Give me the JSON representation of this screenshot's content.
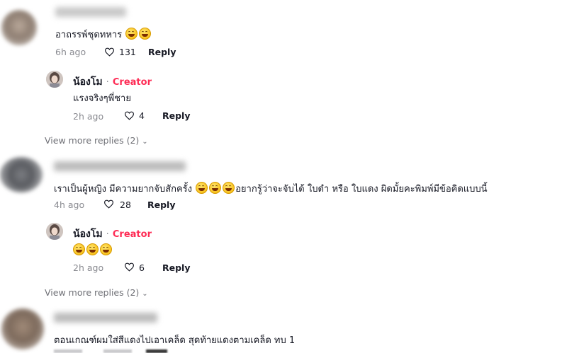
{
  "comments": [
    {
      "text": "อาถรรพ์ชุดทหาร",
      "emoji_count": 2,
      "time": "6h ago",
      "likes": "131",
      "reply_label": "Reply",
      "reply": {
        "name": "น้องโม",
        "separator": "·",
        "badge": "Creator",
        "text": "แรงจริงๆพี่ชาย",
        "time": "2h ago",
        "likes": "4",
        "reply_label": "Reply"
      },
      "view_more": "View more replies (2)"
    },
    {
      "text_part1": "เราเป็นผู้หญิง มีความยากจับสักครั้ง",
      "text_part2": "อยากรู้ว่าจะจับได้ ใบดำ หรือ ใบแดง ผิดมั้ยคะพิมพ์มีข้อคิดแบบนี้",
      "time": "4h ago",
      "likes": "28",
      "reply_label": "Reply",
      "reply": {
        "name": "น้องโม",
        "separator": "·",
        "badge": "Creator",
        "emoji_count": 3,
        "time": "2h ago",
        "likes": "6",
        "reply_label": "Reply"
      },
      "view_more": "View more replies (2)"
    },
    {
      "text": "ตอนเกณฑ์ผมใส่สีแดงไปเอาเคล็ด สุดท้ายแดงตามเคล็ด ทบ 1"
    }
  ],
  "colors": {
    "creator": "#fe2c55",
    "meta": "#8a8b91",
    "text": "#161823"
  }
}
